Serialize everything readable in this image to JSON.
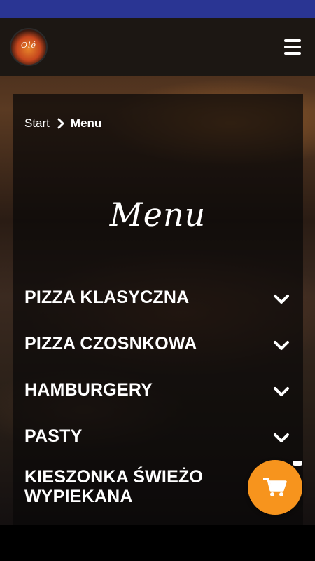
{
  "header": {
    "logo_text": "Olé",
    "logo_icon": "pizza-grill-logo",
    "menu_icon": "hamburger-menu-icon"
  },
  "breadcrumb": {
    "start": "Start",
    "separator_icon": "chevron-right-icon",
    "current": "Menu"
  },
  "page": {
    "title": "Menu"
  },
  "categories": [
    {
      "label": "PIZZA KLASYCZNA"
    },
    {
      "label": "PIZZA CZOSNKOWA"
    },
    {
      "label": "HAMBURGERY"
    },
    {
      "label": "PASTY"
    },
    {
      "label": "KIESZONKA ŚWIEŻO WYPIEKANA"
    }
  ],
  "cart": {
    "icon": "shopping-cart-icon",
    "color": "#f7941d"
  },
  "colors": {
    "status_bar": "#2a3593",
    "header_bg": "#1c1713",
    "accent": "#f7941d"
  }
}
